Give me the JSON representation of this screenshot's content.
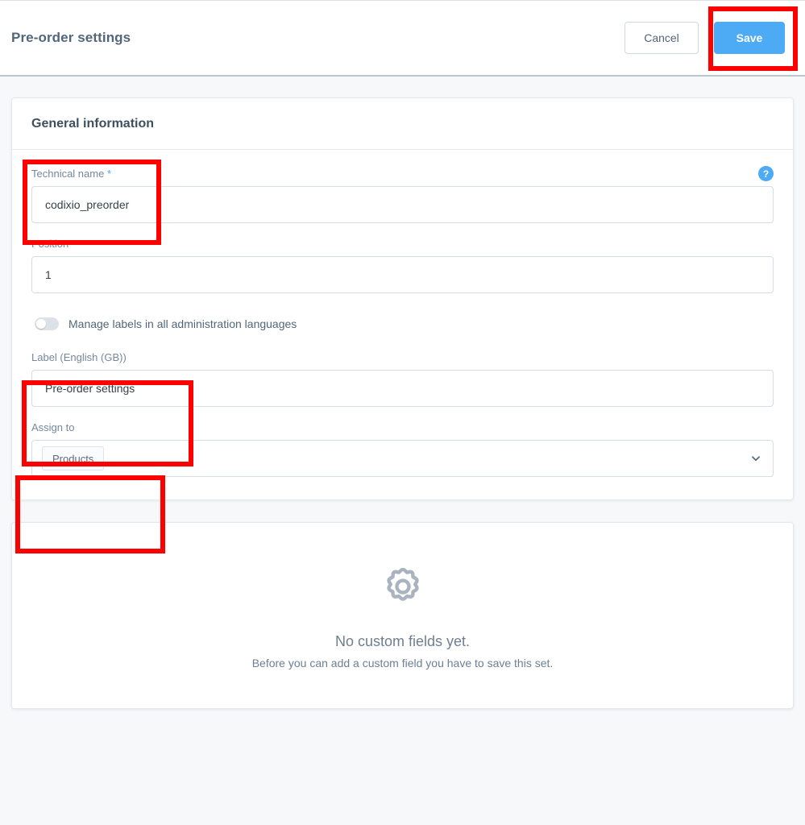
{
  "header": {
    "title": "Pre-order settings",
    "cancel_label": "Cancel",
    "save_label": "Save",
    "save_accent_color": "#4dabf5"
  },
  "general_information": {
    "card_title": "General information",
    "technical_name": {
      "label": "Technical name",
      "required_marker": "*",
      "value": "codixio_preorder",
      "help_icon_glyph": "?"
    },
    "position": {
      "label": "Position",
      "value": "1"
    },
    "manage_labels_switch": {
      "label": "Manage labels in all administration languages",
      "state": "off"
    },
    "label_field": {
      "label": "Label (English (GB))",
      "value": "Pre-order settings"
    },
    "assign_to": {
      "label": "Assign to",
      "chips": [
        "Products"
      ],
      "chevron_glyph": "⌄"
    }
  },
  "custom_fields_empty_state": {
    "icon": "gear-icon",
    "title": "No custom fields yet.",
    "subtitle": "Before you can add a custom field you have to save this set."
  },
  "annotations": {
    "highlight_color": "#ff0000",
    "boxes": [
      "save-button",
      "technical-name-field",
      "label-field",
      "assign-to-field"
    ]
  }
}
